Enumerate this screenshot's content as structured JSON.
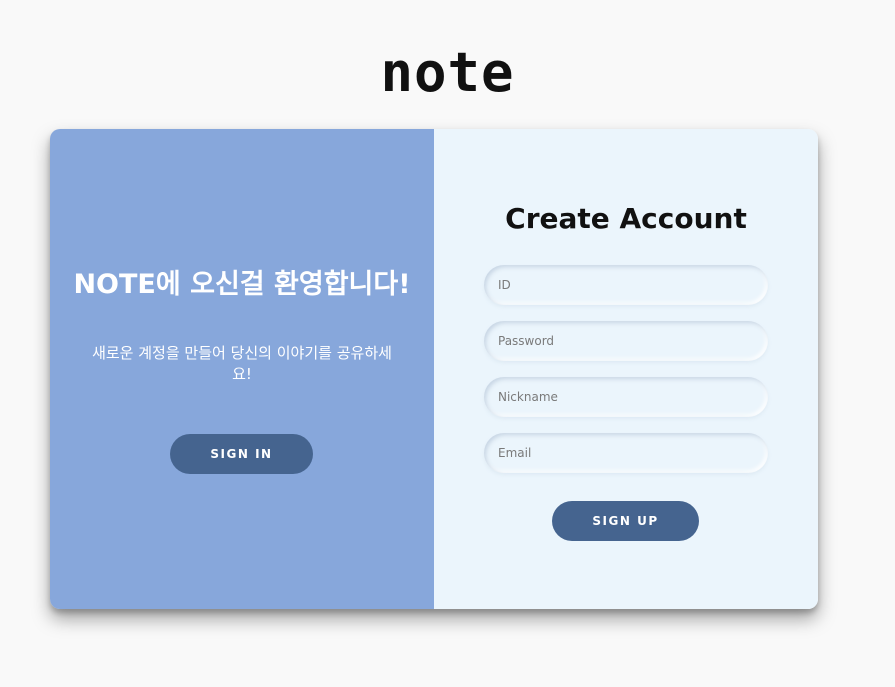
{
  "logo": {
    "text": "note"
  },
  "left_panel": {
    "title": "NOTE에 오신걸 환영합니다!",
    "description": "새로운 계정을 만들어 당신의 이야기를 공유하세요!",
    "sign_in_label": "SIGN IN"
  },
  "right_panel": {
    "title": "Create Account",
    "fields": {
      "id": {
        "placeholder": "ID",
        "value": ""
      },
      "password": {
        "placeholder": "Password",
        "value": ""
      },
      "nickname": {
        "placeholder": "Nickname",
        "value": ""
      },
      "email": {
        "placeholder": "Email",
        "value": ""
      }
    },
    "sign_up_label": "SIGN UP"
  },
  "colors": {
    "page_background": "#f9f9f9",
    "left_panel_background": "#87a7db",
    "right_panel_background": "#ebf5fc",
    "button_background": "#45648f",
    "button_text": "#ffffff"
  }
}
